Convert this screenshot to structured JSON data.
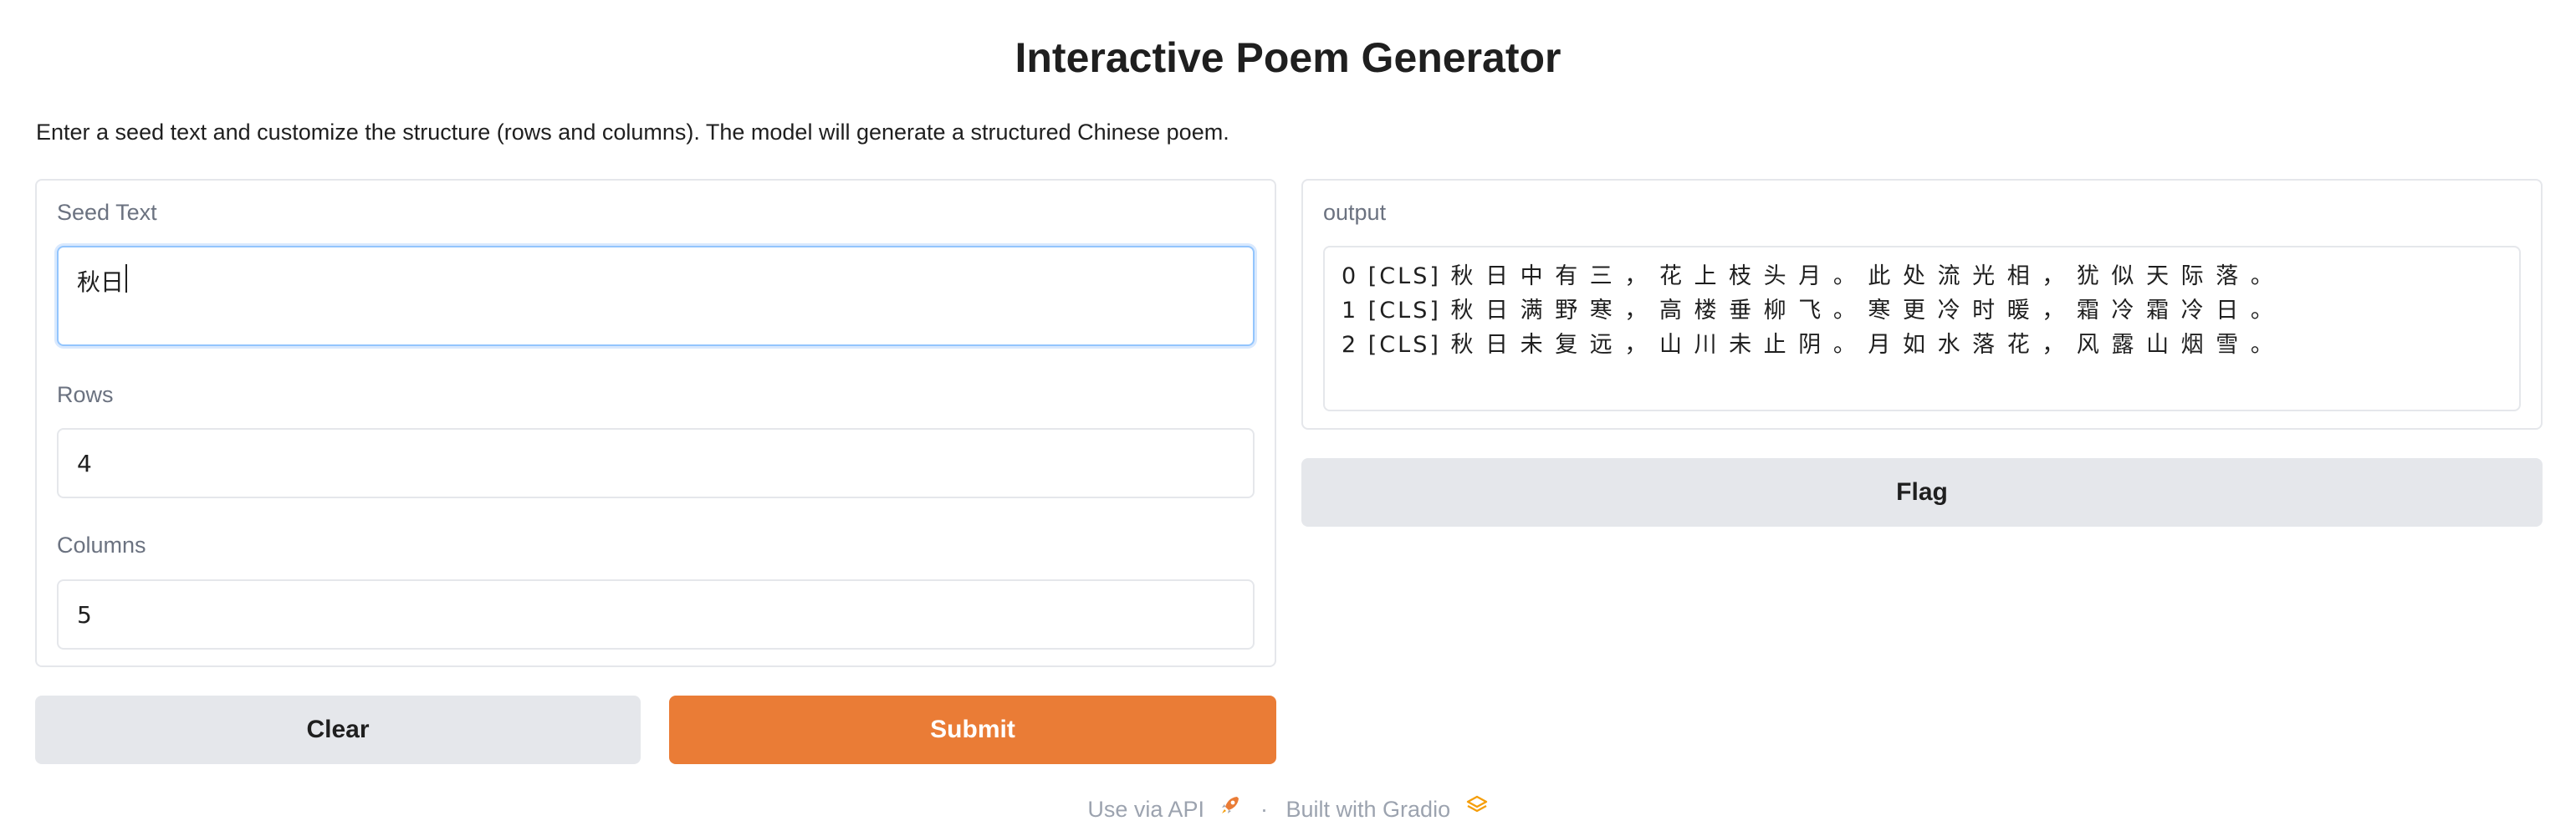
{
  "app": {
    "title": "Interactive Poem Generator",
    "description": "Enter a seed text and customize the structure (rows and columns). The model will generate a structured Chinese poem."
  },
  "inputs": {
    "seed_text": {
      "label": "Seed Text",
      "value": "秋日"
    },
    "rows": {
      "label": "Rows",
      "value": "4"
    },
    "columns": {
      "label": "Columns",
      "value": "5"
    }
  },
  "output": {
    "label": "output",
    "lines": [
      "0 [CLS] 秋 日 中 有 三 ， 花 上 枝 头 月 。 此 处 流 光 相 ， 犹 似 天 际 落 。",
      "1 [CLS] 秋 日 满 野 寒 ， 高 楼 垂 柳 飞 。 寒 更 冷 时 暖 ， 霜 冷 霜 冷 日 。",
      "2 [CLS] 秋 日 未 复 远 ， 山 川 未 止 阴 。 月 如 水 落 花 ， 风 露 山 烟 雪 。"
    ]
  },
  "buttons": {
    "clear": "Clear",
    "submit": "Submit",
    "flag": "Flag"
  },
  "footer": {
    "api_link": "Use via API",
    "separator": "·",
    "built_with": "Built with Gradio"
  },
  "icons": {
    "api": "rocket-icon",
    "gradio": "gradio-logo-icon"
  },
  "colors": {
    "primary": "#ea7c36",
    "secondary": "#e5e7eb",
    "focus_border": "#93c5fd"
  }
}
